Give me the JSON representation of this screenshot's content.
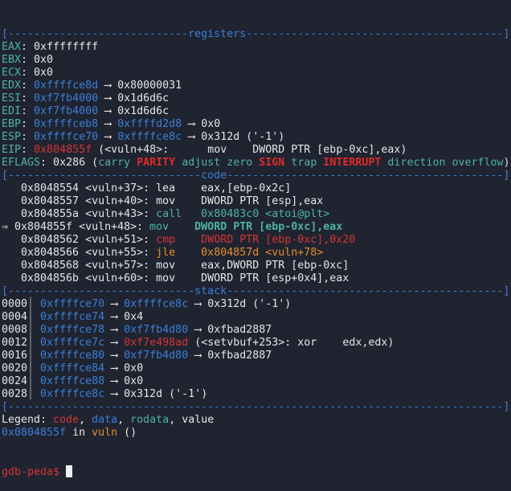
{
  "colors": {
    "background": "#1f2430",
    "text": "#e6e6e6",
    "register_label": "#4fb3a0",
    "data": "#3b7fd9",
    "code": "#d63434",
    "value": "#e6e6e6",
    "rodata": "#4fb3a0",
    "jump": "#e58f2c"
  },
  "lines": [
    {
      "kind": "header",
      "segs": [
        {
          "t": "[----------------------------registers----------------------------------------]",
          "c": "b"
        }
      ]
    },
    {
      "kind": "register",
      "segs": [
        {
          "t": "EAX",
          "c": "t"
        },
        {
          "t": ": 0xffffffff",
          "c": "w"
        }
      ]
    },
    {
      "kind": "register",
      "segs": [
        {
          "t": "EBX",
          "c": "t"
        },
        {
          "t": ": 0x0",
          "c": "w"
        }
      ]
    },
    {
      "kind": "register",
      "segs": [
        {
          "t": "ECX",
          "c": "t"
        },
        {
          "t": ": 0x0",
          "c": "w"
        }
      ]
    },
    {
      "kind": "register",
      "segs": [
        {
          "t": "EDX",
          "c": "t"
        },
        {
          "t": ": ",
          "c": "w"
        },
        {
          "t": "0xffffce8d",
          "c": "b"
        },
        {
          "t": " ⟶ 0x80000031",
          "c": "w"
        }
      ]
    },
    {
      "kind": "register",
      "segs": [
        {
          "t": "ESI",
          "c": "t"
        },
        {
          "t": ": ",
          "c": "w"
        },
        {
          "t": "0xf7fb4000",
          "c": "b"
        },
        {
          "t": " ⟶ 0x1d6d6c",
          "c": "w"
        }
      ]
    },
    {
      "kind": "register",
      "segs": [
        {
          "t": "EDI",
          "c": "t"
        },
        {
          "t": ": ",
          "c": "w"
        },
        {
          "t": "0xf7fb4000",
          "c": "b"
        },
        {
          "t": " ⟶ 0x1d6d6c",
          "c": "w"
        }
      ]
    },
    {
      "kind": "register",
      "segs": [
        {
          "t": "EBP",
          "c": "t"
        },
        {
          "t": ": ",
          "c": "w"
        },
        {
          "t": "0xffffceb8",
          "c": "b"
        },
        {
          "t": " ⟶ ",
          "c": "w"
        },
        {
          "t": "0xffffd2d8",
          "c": "b"
        },
        {
          "t": " ⟶ 0x0",
          "c": "w"
        }
      ]
    },
    {
      "kind": "register",
      "segs": [
        {
          "t": "ESP",
          "c": "t"
        },
        {
          "t": ": ",
          "c": "w"
        },
        {
          "t": "0xffffce70",
          "c": "b"
        },
        {
          "t": " ⟶ ",
          "c": "w"
        },
        {
          "t": "0xffffce8c",
          "c": "b"
        },
        {
          "t": " ⟶ 0x312d ('-1')",
          "c": "w"
        }
      ]
    },
    {
      "kind": "register",
      "segs": [
        {
          "t": "EIP",
          "c": "t"
        },
        {
          "t": ": ",
          "c": "w"
        },
        {
          "t": "0x804855f",
          "c": "r"
        },
        {
          "t": " (<vuln+48>:      mov    DWORD PTR [ebp-0xc],eax)",
          "c": "w"
        }
      ]
    },
    {
      "kind": "register",
      "segs": [
        {
          "t": "EFLAGS",
          "c": "t"
        },
        {
          "t": ": 0x286 (",
          "c": "w"
        },
        {
          "t": "carry ",
          "c": "t"
        },
        {
          "t": "PARITY",
          "c": "R"
        },
        {
          "t": " adjust zero ",
          "c": "t"
        },
        {
          "t": "SIGN",
          "c": "R"
        },
        {
          "t": " trap ",
          "c": "t"
        },
        {
          "t": "INTERRUPT",
          "c": "R"
        },
        {
          "t": " direction overflow",
          "c": "t"
        },
        {
          "t": ")",
          "c": "w"
        }
      ]
    },
    {
      "kind": "header",
      "segs": [
        {
          "t": "[------------------------------code-------------------------------------------]",
          "c": "b"
        }
      ]
    },
    {
      "kind": "code",
      "segs": [
        {
          "t": "   0x8048554 <vuln+37>: lea    eax,[ebp-0x2c]",
          "c": "w"
        }
      ]
    },
    {
      "kind": "code",
      "segs": [
        {
          "t": "   0x8048557 <vuln+40>: mov    DWORD PTR [esp],eax",
          "c": "w"
        }
      ]
    },
    {
      "kind": "code",
      "segs": [
        {
          "t": "   0x804855a <vuln+43>: ",
          "c": "w"
        },
        {
          "t": "call   0x80483c0 <atoi@plt>",
          "c": "t"
        }
      ]
    },
    {
      "kind": "code-current",
      "segs": [
        {
          "t": "⇒ 0x804855f <vuln+48>: ",
          "c": "w"
        },
        {
          "t": "mov    ",
          "c": "t"
        },
        {
          "t": "DWORD PTR [ebp-0xc],eax",
          "c": "T"
        }
      ]
    },
    {
      "kind": "code",
      "segs": [
        {
          "t": "   0x8048562 <vuln+51>: ",
          "c": "w"
        },
        {
          "t": "cmp    DWORD PTR [ebp-0xc],0x20",
          "c": "r"
        }
      ]
    },
    {
      "kind": "code",
      "segs": [
        {
          "t": "   0x8048566 <vuln+55>: ",
          "c": "w"
        },
        {
          "t": "jle    0x804857d <vuln+78>",
          "c": "o"
        }
      ]
    },
    {
      "kind": "code",
      "segs": [
        {
          "t": "   0x8048568 <vuln+57>: mov    eax,DWORD PTR [ebp-0xc]",
          "c": "w"
        }
      ]
    },
    {
      "kind": "code",
      "segs": [
        {
          "t": "   0x804856b <vuln+60>: mov    DWORD PTR [esp+0x4],eax",
          "c": "w"
        }
      ]
    },
    {
      "kind": "header",
      "segs": [
        {
          "t": "[-----------------------------stack-------------------------------------------]",
          "c": "b"
        }
      ]
    },
    {
      "kind": "stack",
      "segs": [
        {
          "t": "0000",
          "c": "w"
        },
        {
          "t": "│ ",
          "c": "g"
        },
        {
          "t": "0xffffce70",
          "c": "b"
        },
        {
          "t": " ⟶ ",
          "c": "w"
        },
        {
          "t": "0xffffce8c",
          "c": "b"
        },
        {
          "t": " ⟶ 0x312d ('-1')",
          "c": "w"
        }
      ]
    },
    {
      "kind": "stack",
      "segs": [
        {
          "t": "0004",
          "c": "w"
        },
        {
          "t": "│ ",
          "c": "g"
        },
        {
          "t": "0xffffce74",
          "c": "b"
        },
        {
          "t": " ⟶ 0x4",
          "c": "w"
        }
      ]
    },
    {
      "kind": "stack",
      "segs": [
        {
          "t": "0008",
          "c": "w"
        },
        {
          "t": "│ ",
          "c": "g"
        },
        {
          "t": "0xffffce78",
          "c": "b"
        },
        {
          "t": " ⟶ ",
          "c": "w"
        },
        {
          "t": "0xf7fb4d80",
          "c": "b"
        },
        {
          "t": " ⟶ 0xfbad2887",
          "c": "w"
        }
      ]
    },
    {
      "kind": "stack",
      "segs": [
        {
          "t": "0012",
          "c": "w"
        },
        {
          "t": "│ ",
          "c": "g"
        },
        {
          "t": "0xffffce7c",
          "c": "b"
        },
        {
          "t": " ⟶ ",
          "c": "w"
        },
        {
          "t": "0xf7e498ad",
          "c": "r"
        },
        {
          "t": " (<setvbuf+253>: xor    edx,edx)",
          "c": "w"
        }
      ]
    },
    {
      "kind": "stack",
      "segs": [
        {
          "t": "0016",
          "c": "w"
        },
        {
          "t": "│ ",
          "c": "g"
        },
        {
          "t": "0xffffce80",
          "c": "b"
        },
        {
          "t": " ⟶ ",
          "c": "w"
        },
        {
          "t": "0xf7fb4d80",
          "c": "b"
        },
        {
          "t": " ⟶ 0xfbad2887",
          "c": "w"
        }
      ]
    },
    {
      "kind": "stack",
      "segs": [
        {
          "t": "0020",
          "c": "w"
        },
        {
          "t": "│ ",
          "c": "g"
        },
        {
          "t": "0xffffce84",
          "c": "b"
        },
        {
          "t": " ⟶ 0x0",
          "c": "w"
        }
      ]
    },
    {
      "kind": "stack",
      "segs": [
        {
          "t": "0024",
          "c": "w"
        },
        {
          "t": "│ ",
          "c": "g"
        },
        {
          "t": "0xffffce88",
          "c": "b"
        },
        {
          "t": " ⟶ 0x0",
          "c": "w"
        }
      ]
    },
    {
      "kind": "stack",
      "segs": [
        {
          "t": "0028",
          "c": "w"
        },
        {
          "t": "│ ",
          "c": "g"
        },
        {
          "t": "0xffffce8c",
          "c": "b"
        },
        {
          "t": " ⟶ 0x312d ('-1')",
          "c": "w"
        }
      ]
    },
    {
      "kind": "header",
      "segs": [
        {
          "t": "[-----------------------------------------------------------------------------]",
          "c": "b"
        }
      ]
    },
    {
      "kind": "legend",
      "segs": [
        {
          "t": "Legend: ",
          "c": "w"
        },
        {
          "t": "code",
          "c": "r"
        },
        {
          "t": ", ",
          "c": "w"
        },
        {
          "t": "data",
          "c": "b"
        },
        {
          "t": ", ",
          "c": "w"
        },
        {
          "t": "rodata",
          "c": "t"
        },
        {
          "t": ", value",
          "c": "w"
        }
      ]
    },
    {
      "kind": "location",
      "segs": [
        {
          "t": "0x0804855f",
          "c": "b"
        },
        {
          "t": " in ",
          "c": "w"
        },
        {
          "t": "vuln",
          "c": "o"
        },
        {
          "t": " ()",
          "c": "w"
        }
      ]
    }
  ],
  "prompt": "gdb-peda$ "
}
